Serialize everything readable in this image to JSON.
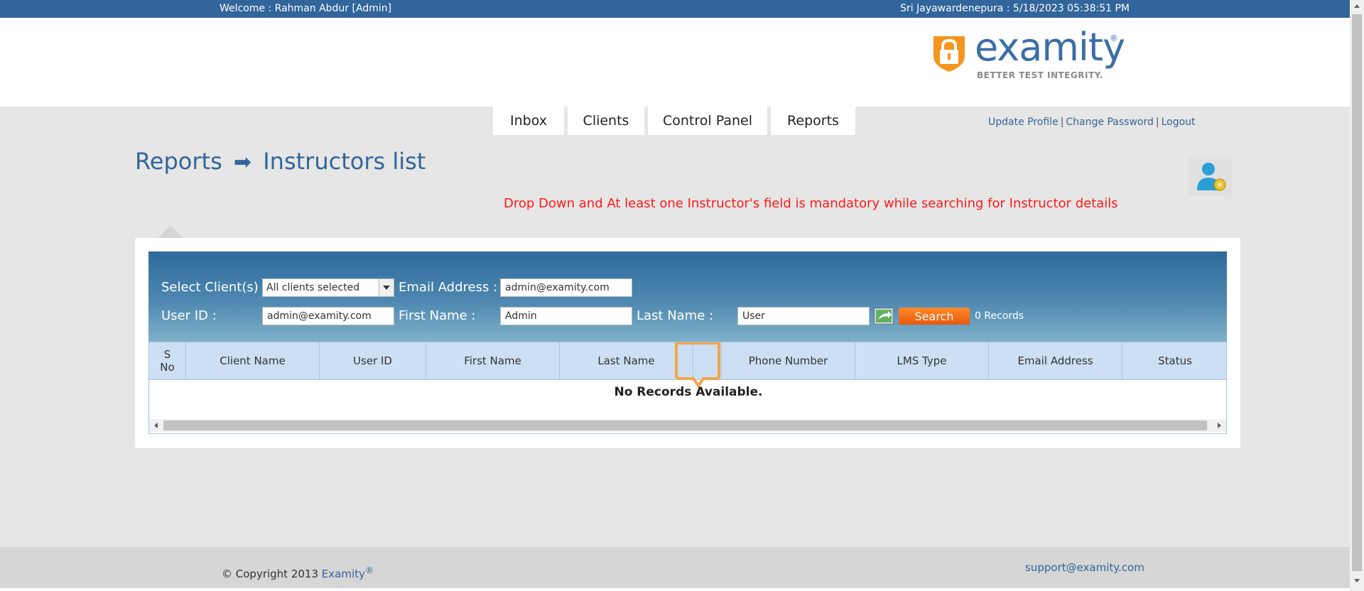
{
  "topbar": {
    "welcome": "Welcome : Rahman Abdur [Admin]",
    "datetime": "Sri Jayawardenepura : 5/18/2023 05:38:51 PM"
  },
  "logo": {
    "brand": "examity",
    "reg": "®",
    "tagline": "BETTER TEST INTEGRITY."
  },
  "nav": {
    "tabs": [
      {
        "label": "Inbox"
      },
      {
        "label": "Clients"
      },
      {
        "label": "Control Panel"
      },
      {
        "label": "Reports"
      }
    ]
  },
  "user_links": {
    "update_profile": "Update Profile",
    "change_password": "Change Password",
    "logout": "Logout",
    "separator": "|"
  },
  "page": {
    "breadcrumb_parent": "Reports",
    "breadcrumb_arrow": "➡",
    "title": "Instructors list",
    "warning": "Drop Down and At least one Instructor's field is mandatory while searching for Instructor details"
  },
  "search": {
    "client_label": "Select Client(s) :",
    "client_value": "All clients selected",
    "email_label": "Email Address :",
    "email_value": "admin@examity.com",
    "userid_label": "User ID :",
    "userid_value": "admin@examity.com",
    "firstname_label": "First Name :",
    "firstname_value": "Admin",
    "lastname_label": "Last Name :",
    "lastname_value": "User",
    "search_button": "Search",
    "records_count": "0 Records"
  },
  "table": {
    "columns": [
      "S No",
      "Client Name",
      "User ID",
      "First Name",
      "Last Name",
      "",
      "Phone Number",
      "LMS Type",
      "Email Address",
      "Status"
    ],
    "empty_message": "No Records Available."
  },
  "footer": {
    "copyright": "© Copyright 2013",
    "brand": "Examity",
    "reg": "®",
    "support_email": "support@examity.com"
  },
  "colors": {
    "topbar": "#31659b",
    "brand_blue": "#3b6ea5",
    "warning": "#ff1a1a",
    "search_button": "#f26f1a",
    "logo_orange": "#f7941d"
  }
}
